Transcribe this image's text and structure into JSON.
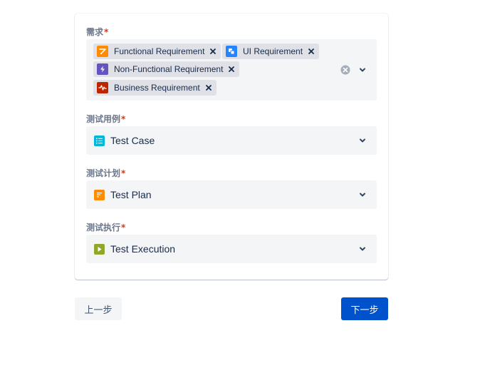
{
  "form": {
    "requirements": {
      "label": "需求",
      "required_mark": "*",
      "tags": [
        {
          "label": "Functional Requirement",
          "icon": "functional-requirement-icon",
          "color": "#ff8b00"
        },
        {
          "label": "UI Requirement",
          "icon": "ui-requirement-icon",
          "color": "#2684ff"
        },
        {
          "label": "Non-Functional Requirement",
          "icon": "lightning-icon",
          "color": "#6554c0"
        },
        {
          "label": "Business Requirement",
          "icon": "pulse-icon",
          "color": "#bf2600"
        }
      ]
    },
    "test_case": {
      "label": "测试用例",
      "required_mark": "*",
      "value": "Test Case",
      "icon": "test-case-icon",
      "color": "#00b8d9"
    },
    "test_plan": {
      "label": "测试计划",
      "required_mark": "*",
      "value": "Test Plan",
      "icon": "test-plan-icon",
      "color": "#ff8b00"
    },
    "test_execution": {
      "label": "测试执行",
      "required_mark": "*",
      "value": "Test Execution",
      "icon": "test-execution-icon",
      "color": "#8fa82c"
    }
  },
  "buttons": {
    "prev_label": "上一步",
    "next_label": "下一步"
  },
  "colors": {
    "primary": "#0052cc",
    "required": "#de350b",
    "field_bg": "#f4f5f7",
    "tag_bg": "#dfe1e6"
  }
}
